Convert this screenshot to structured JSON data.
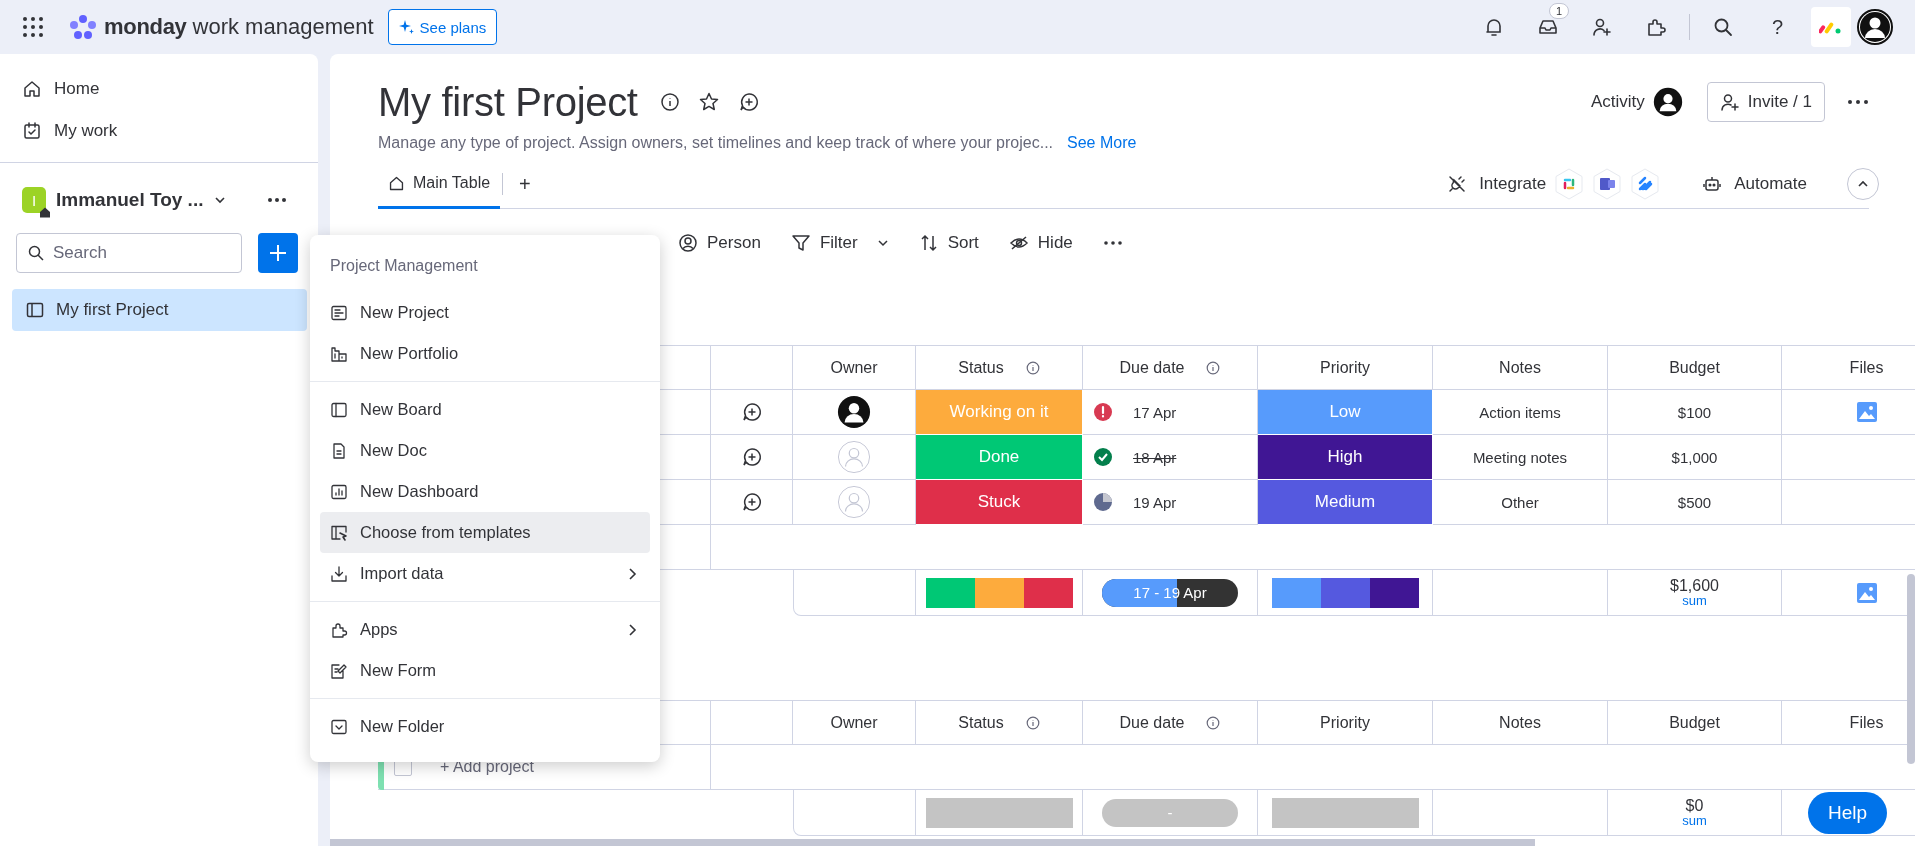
{
  "topbar": {
    "brand": "monday",
    "product": "work management",
    "plans_button": "See plans",
    "inbox_badge": "1",
    "help": "?"
  },
  "sidebar": {
    "nav": [
      {
        "label": "Home",
        "kind": "home"
      },
      {
        "label": "My work",
        "kind": "calendar"
      }
    ],
    "workspace": {
      "initial": "I",
      "name": "Immanuel Toy ..."
    },
    "search": {
      "placeholder": "Search"
    },
    "boards": [
      {
        "label": "My first Project",
        "selected": true
      }
    ]
  },
  "board": {
    "title": "My first Project",
    "description": "Manage any type of project. Assign owners, set timelines and keep track of where your projec...",
    "see_more": "See More",
    "activity": "Activity",
    "invite": "Invite / 1",
    "tabs": [
      {
        "label": "Main Table",
        "selected": true
      }
    ],
    "add_tab": "+",
    "integrate": "Integrate",
    "automate": "Automate",
    "toolbar": [
      {
        "label": "Person",
        "kind": "person"
      },
      {
        "label": "Filter",
        "kind": "filter"
      },
      {
        "label": "Sort",
        "kind": "sort"
      },
      {
        "label": "Hide",
        "kind": "hide"
      }
    ]
  },
  "groups": [
    {
      "columns": [
        {
          "label": "Owner",
          "info": false
        },
        {
          "label": "Status",
          "info": true
        },
        {
          "label": "Due date",
          "info": true
        },
        {
          "label": "Priority",
          "info": false
        },
        {
          "label": "Notes",
          "info": false
        },
        {
          "label": "Budget",
          "info": false
        },
        {
          "label": "Files",
          "info": false
        }
      ],
      "rows": [
        {
          "owner_assigned": true,
          "status": {
            "label": "Working on it",
            "color": "#fdab3d"
          },
          "due": {
            "kind": "alert",
            "date": "17 Apr",
            "done": false
          },
          "priority": {
            "label": "Low",
            "color": "#579bfc"
          },
          "notes": "Action items",
          "budget": "$100",
          "has_file": true
        },
        {
          "owner_assigned": false,
          "status": {
            "label": "Done",
            "color": "#00c875"
          },
          "due": {
            "kind": "done",
            "date": "18 Apr",
            "done": true
          },
          "priority": {
            "label": "High",
            "color": "#401694"
          },
          "notes": "Meeting notes",
          "budget": "$1,000",
          "has_file": false
        },
        {
          "owner_assigned": false,
          "status": {
            "label": "Stuck",
            "color": "#df2f4a"
          },
          "due": {
            "kind": "pending",
            "date": "19 Apr",
            "done": false
          },
          "priority": {
            "label": "Medium",
            "color": "#5559df"
          },
          "notes": "Other",
          "budget": "$500",
          "has_file": false
        }
      ],
      "summary": {
        "status_segments": [
          {
            "color": "#00c875"
          },
          {
            "color": "#fdab3d"
          },
          {
            "color": "#df2f4a"
          }
        ],
        "timeline": {
          "label": "17 - 19 Apr",
          "level": 0.55
        },
        "priority_segments": [
          {
            "color": "#579bfc"
          },
          {
            "color": "#5559df"
          },
          {
            "color": "#401694"
          }
        ],
        "budget": "$1,600",
        "budget_label": "sum",
        "has_file": true
      }
    },
    {
      "color": "#7ee0b1",
      "columns": [
        {
          "label": "Owner",
          "info": false
        },
        {
          "label": "Status",
          "info": true
        },
        {
          "label": "Due date",
          "info": true
        },
        {
          "label": "Priority",
          "info": false
        },
        {
          "label": "Notes",
          "info": false
        },
        {
          "label": "Budget",
          "info": false
        },
        {
          "label": "Files",
          "info": false
        }
      ],
      "add_row": {
        "label": "+ Add project",
        "checked": false
      },
      "summary": {
        "timeline": {
          "label": "-"
        },
        "budget": "$0",
        "budget_label": "sum"
      }
    }
  ],
  "menu": {
    "title": "Project Management",
    "sections": [
      {
        "items": [
          {
            "label": "New Project",
            "kind": "project",
            "selected": false,
            "submenu": false
          },
          {
            "label": "New Portfolio",
            "kind": "portfolio",
            "selected": false,
            "submenu": false
          }
        ]
      },
      {
        "items": [
          {
            "label": "New Board",
            "kind": "board",
            "selected": false,
            "submenu": false
          },
          {
            "label": "New Doc",
            "kind": "doc",
            "selected": false,
            "submenu": false
          },
          {
            "label": "New Dashboard",
            "kind": "dashboard",
            "selected": false,
            "submenu": false
          },
          {
            "label": "Choose from templates",
            "kind": "templates",
            "selected": true,
            "submenu": false
          },
          {
            "label": "Import data",
            "kind": "import",
            "selected": false,
            "submenu": true
          }
        ]
      },
      {
        "items": [
          {
            "label": "Apps",
            "kind": "apps",
            "selected": false,
            "submenu": true
          },
          {
            "label": "New Form",
            "kind": "form",
            "selected": false,
            "submenu": false
          }
        ]
      },
      {
        "items": [
          {
            "label": "New Folder",
            "kind": "folder",
            "selected": false,
            "submenu": false
          }
        ]
      }
    ]
  },
  "help_button": "Help"
}
